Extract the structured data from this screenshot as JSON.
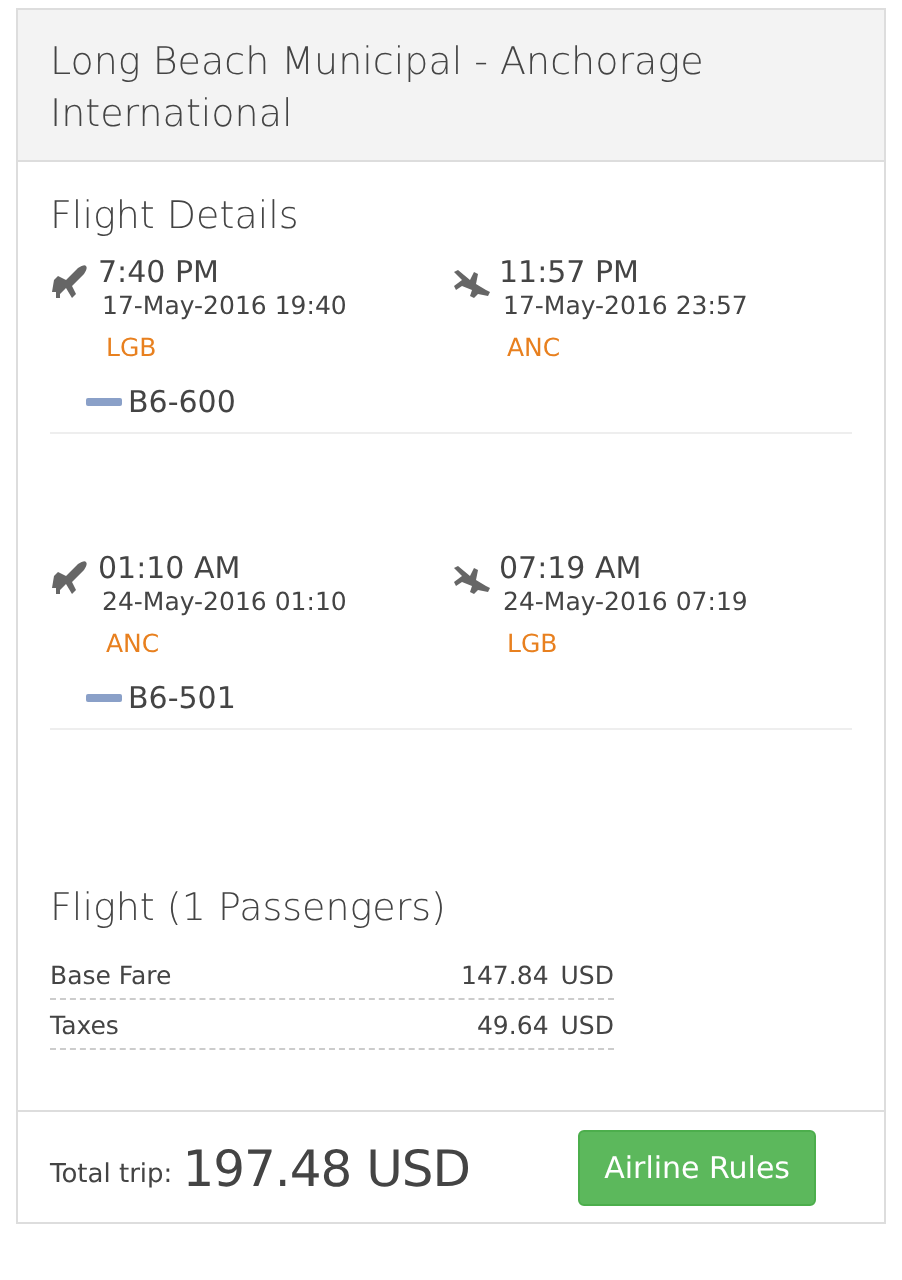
{
  "header": {
    "title": "Long Beach Municipal - Anchorage International"
  },
  "flight_details": {
    "title": "Flight Details",
    "segments": [
      {
        "endpoints": [
          {
            "kind": "departure",
            "time": "7:40 PM",
            "datetime": "17-May-2016 19:40",
            "airport": "LGB"
          },
          {
            "kind": "arrival",
            "time": "11:57 PM",
            "datetime": "17-May-2016 23:57",
            "airport": "ANC"
          }
        ],
        "flight_number": "B6-600"
      },
      {
        "endpoints": [
          {
            "kind": "departure",
            "time": "01:10 AM",
            "datetime": "24-May-2016 01:10",
            "airport": "ANC"
          },
          {
            "kind": "arrival",
            "time": "07:19 AM",
            "datetime": "24-May-2016 07:19",
            "airport": "LGB"
          }
        ],
        "flight_number": "B6-501"
      }
    ]
  },
  "fare": {
    "title": "Flight (1 Passengers)",
    "rows": [
      {
        "label": "Base Fare",
        "amount": "147.84",
        "currency": "USD"
      },
      {
        "label": "Taxes",
        "amount": "49.64",
        "currency": "USD"
      }
    ]
  },
  "footer": {
    "total_label": "Total trip:",
    "total": "197.48 USD",
    "button": "Airline Rules"
  }
}
